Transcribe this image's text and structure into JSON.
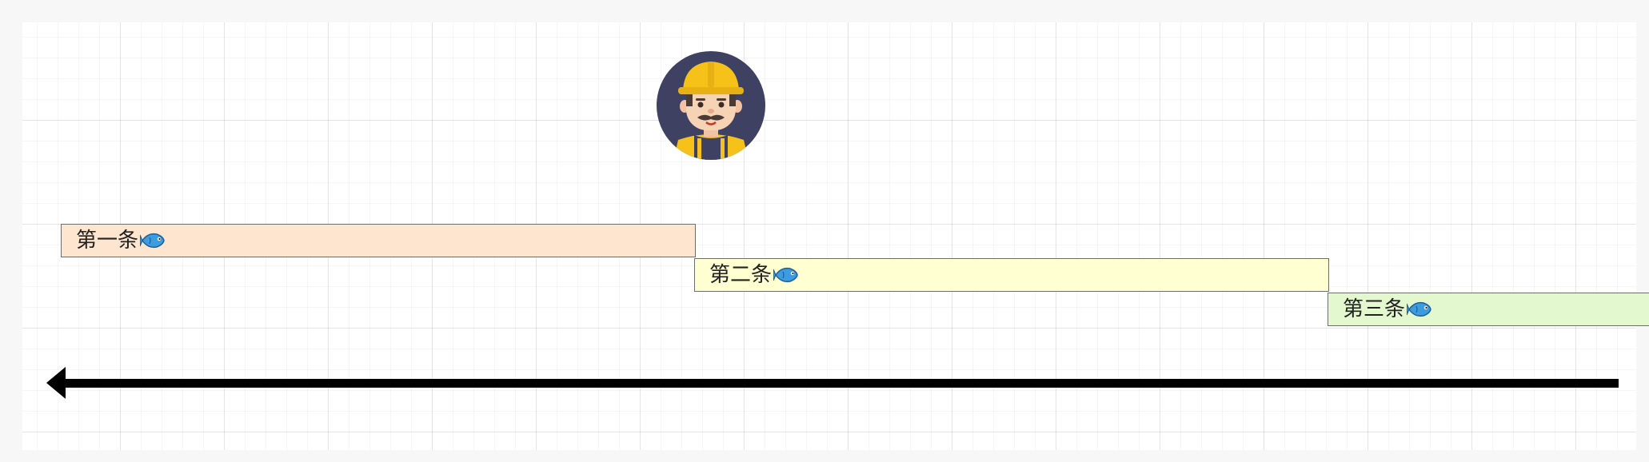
{
  "diagram": {
    "bars": [
      {
        "label": "第一条",
        "icon": "fish-icon",
        "color": "#fde5cf"
      },
      {
        "label": "第二条",
        "icon": "fish-icon",
        "color": "#ffffd2"
      },
      {
        "label": "第三条",
        "icon": "fish-icon",
        "color": "#e4f8cf"
      }
    ],
    "avatar": {
      "icon": "construction-worker-avatar-icon"
    },
    "arrow": {
      "direction": "left",
      "color": "#000000"
    }
  }
}
